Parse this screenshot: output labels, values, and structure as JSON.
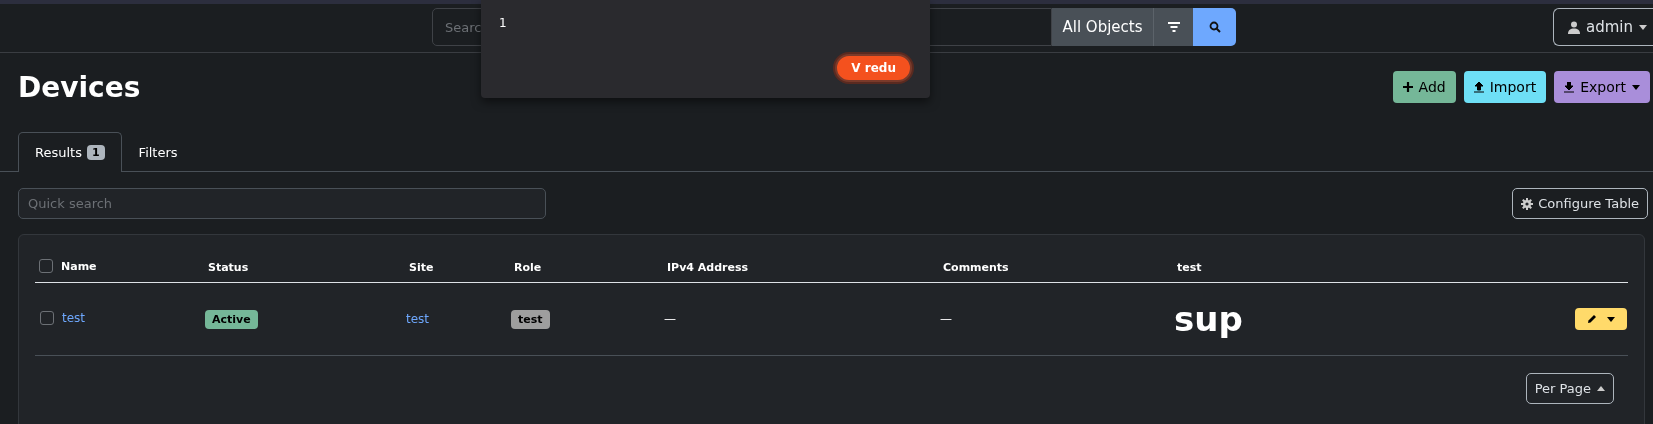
{
  "top_bar": {
    "search": {
      "placeholder": "Searc"
    },
    "scope": "All Objects",
    "user": "admin"
  },
  "dialog": {
    "message": "1",
    "button": "V redu"
  },
  "page": {
    "title": "Devices",
    "actions": [
      {
        "label": "Add",
        "kind": "add"
      },
      {
        "label": "Import",
        "kind": "import"
      },
      {
        "label": "Export",
        "kind": "export"
      }
    ]
  },
  "tabs": [
    {
      "label": "Results",
      "badge": "1",
      "selected": true
    },
    {
      "label": "Filters",
      "selected": false
    }
  ],
  "quick_search": {
    "placeholder": "Quick search"
  },
  "configure_button": "Configure Table",
  "table": {
    "all_checked": false,
    "columns": [
      "Name",
      "Status",
      "Site",
      "Role",
      "IPv4 Address",
      "Comments",
      "test"
    ],
    "rows": [
      {
        "checked": false,
        "name": "test",
        "status": "Active",
        "site": "test",
        "role": "test",
        "ipv4": "—",
        "comments": "—",
        "test": "sup"
      }
    ]
  },
  "per_page": "Per Page"
}
